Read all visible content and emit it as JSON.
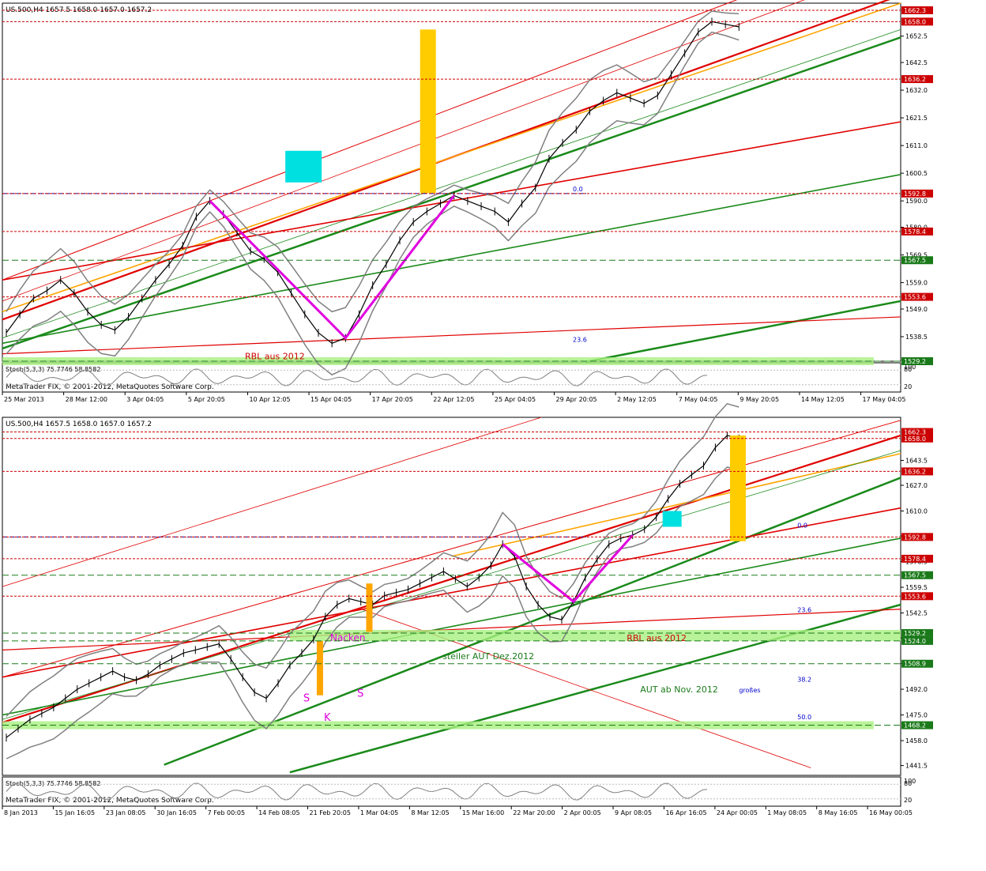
{
  "chart_data": [
    {
      "type": "line",
      "symbol_header": "US.500,H4  1657.5 1658.0 1657.0 1657.2",
      "copyright": "MetaTrader FIX, © 2001-2012, MetaQuotes Software Corp.",
      "stoch_label": "Stoch(5,3,3) 75.7746 58.8582",
      "stoch_axis": [
        "100",
        "80",
        "20"
      ],
      "y_ticks": [
        "1652.5",
        "1642.5",
        "1632.0",
        "1621.5",
        "1611.0",
        "1600.5",
        "1590.0",
        "1580.0",
        "1569.5",
        "1559.0",
        "1549.0",
        "1538.5"
      ],
      "ylim": [
        1529.2,
        1665.0
      ],
      "x_ticks": [
        "25 Mar 2013",
        "28 Mar 12:00",
        "3 Apr 04:05",
        "5 Apr 20:05",
        "10 Apr 12:05",
        "15 Apr 04:05",
        "17 Apr 20:05",
        "22 Apr 12:05",
        "25 Apr 04:05",
        "29 Apr 20:05",
        "2 May 12:05",
        "7 May 04:05",
        "9 May 20:05",
        "14 May 12:05",
        "17 May 04:05"
      ],
      "level_labels": [
        {
          "value": 1662.3,
          "text": "1662.3",
          "color": "#cc0000"
        },
        {
          "value": 1658.0,
          "text": "1658.0",
          "color": "#cc0000"
        },
        {
          "value": 1636.2,
          "text": "1636.2",
          "color": "#cc0000"
        },
        {
          "value": 1592.8,
          "text": "1592.8",
          "color": "#cc0000"
        },
        {
          "value": 1578.4,
          "text": "1578.4",
          "color": "#cc0000"
        },
        {
          "value": 1567.5,
          "text": "1567.5",
          "color": "#1a7a1a"
        },
        {
          "value": 1553.6,
          "text": "1553.6",
          "color": "#cc0000"
        },
        {
          "value": 1529.2,
          "text": "1529.2",
          "color": "#1a7a1a"
        }
      ],
      "fib_labels": [
        "0.0",
        "23.6"
      ],
      "annotations": [
        "RBL aus 2012"
      ],
      "price_series": [
        1540,
        1547,
        1553,
        1556,
        1560,
        1555,
        1548,
        1543,
        1541,
        1546,
        1553,
        1560,
        1566,
        1573,
        1584,
        1590,
        1585,
        1578,
        1571,
        1568,
        1563,
        1555,
        1547,
        1540,
        1536,
        1538,
        1547,
        1558,
        1566,
        1575,
        1582,
        1586,
        1589,
        1592,
        1590,
        1588,
        1586,
        1582,
        1589,
        1595,
        1606,
        1612,
        1617,
        1624,
        1628,
        1631,
        1629,
        1627,
        1630,
        1638,
        1646,
        1654,
        1658,
        1657,
        1656
      ],
      "colors": {
        "red": "#e00000",
        "green": "#1a8a1a",
        "orange": "#ffa500",
        "magenta": "#e000e0",
        "gold": "#ffcc00",
        "cyan": "#00e0e0",
        "bands": "#808080"
      }
    },
    {
      "type": "line",
      "symbol_header": "US.500,H4  1657.5 1658.0 1657.0 1657.2",
      "copyright": "MetaTrader FIX, © 2001-2012, MetaQuotes Software Corp.",
      "stoch_label": "Stoch(5,3,3) 75.7746 58.8582",
      "stoch_axis": [
        "100",
        "80",
        "20"
      ],
      "y_ticks": [
        "1643.5",
        "1627.0",
        "1610.0",
        "1593.5",
        "1576.5",
        "1559.5",
        "1542.5",
        "1526.0",
        "1509.0",
        "1492.0",
        "1475.0",
        "1458.0",
        "1441.5"
      ],
      "ylim": [
        1435.0,
        1672.0
      ],
      "x_ticks": [
        "8 Jan 2013",
        "15 Jan 16:05",
        "23 Jan 08:05",
        "30 Jan 16:05",
        "7 Feb 00:05",
        "14 Feb 08:05",
        "21 Feb 20:05",
        "1 Mar 04:05",
        "8 Mar 12:05",
        "15 Mar 16:00",
        "22 Mar 20:00",
        "2 Apr 00:05",
        "9 Apr 08:05",
        "16 Apr 16:05",
        "24 Apr 00:05",
        "1 May 08:05",
        "8 May 16:05",
        "16 May 00:05"
      ],
      "level_labels": [
        {
          "value": 1662.3,
          "text": "1662.3",
          "color": "#cc0000"
        },
        {
          "value": 1658.0,
          "text": "1658.0",
          "color": "#cc0000"
        },
        {
          "value": 1636.2,
          "text": "1636.2",
          "color": "#cc0000"
        },
        {
          "value": 1592.8,
          "text": "1592.8",
          "color": "#cc0000"
        },
        {
          "value": 1578.4,
          "text": "1578.4",
          "color": "#cc0000"
        },
        {
          "value": 1567.5,
          "text": "1567.5",
          "color": "#1a7a1a"
        },
        {
          "value": 1553.6,
          "text": "1553.6",
          "color": "#cc0000"
        },
        {
          "value": 1529.2,
          "text": "1529.2",
          "color": "#1a7a1a"
        },
        {
          "value": 1524.0,
          "text": "1524.0",
          "color": "#1a7a1a"
        },
        {
          "value": 1508.9,
          "text": "1508.9",
          "color": "#1a7a1a"
        },
        {
          "value": 1468.2,
          "text": "1468.2",
          "color": "#1a7a1a"
        }
      ],
      "fib_labels": [
        "0.0",
        "23.6",
        "38.2",
        "50.0"
      ],
      "annotations": [
        "RBL aus 2012",
        "steiler AUT Dez.2012",
        "AUT ab Nov. 2012",
        "großes",
        "Nacken",
        "S",
        "S",
        "K"
      ],
      "price_series": [
        1460,
        1466,
        1472,
        1476,
        1480,
        1486,
        1492,
        1496,
        1500,
        1504,
        1500,
        1498,
        1502,
        1508,
        1512,
        1516,
        1518,
        1520,
        1522,
        1512,
        1500,
        1490,
        1486,
        1496,
        1508,
        1516,
        1525,
        1540,
        1548,
        1552,
        1550,
        1548,
        1554,
        1556,
        1558,
        1562,
        1566,
        1570,
        1565,
        1560,
        1566,
        1574,
        1588,
        1580,
        1560,
        1548,
        1540,
        1538,
        1550,
        1566,
        1578,
        1588,
        1592,
        1594,
        1598,
        1606,
        1618,
        1628,
        1634,
        1640,
        1652,
        1660,
        1658
      ],
      "colors": {
        "red": "#e00000",
        "green": "#1a8a1a",
        "orange": "#ffa500",
        "magenta": "#e000e0",
        "gold": "#ffcc00",
        "cyan": "#00e0e0",
        "bands": "#808080"
      }
    }
  ]
}
